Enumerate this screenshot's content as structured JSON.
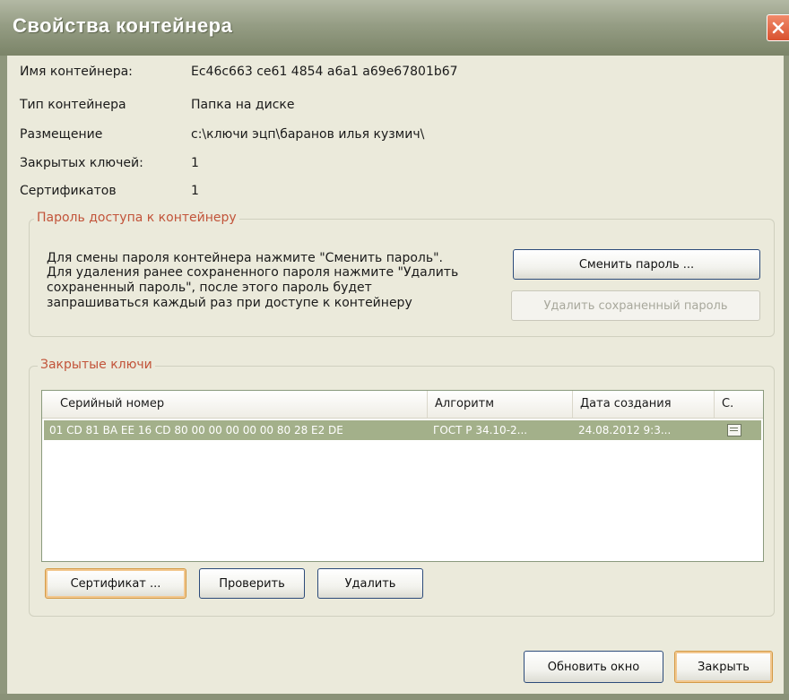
{
  "window": {
    "title": "Свойства контейнера"
  },
  "properties": [
    {
      "label": "Имя контейнера:",
      "value": "Ec46c663 ce61 4854 a6a1 a69e67801b67"
    },
    {
      "label": "Тип контейнера",
      "value": "Папка на диске"
    },
    {
      "label": "Размещение",
      "value": "c:\\ключи эцп\\баранов илья кузмич\\"
    },
    {
      "label": "Закрытых ключей:",
      "value": "1"
    },
    {
      "label": "Сертификатов",
      "value": "1"
    }
  ],
  "password_group": {
    "legend": "Пароль доступа к контейнеру",
    "hint_lines": [
      "Для смены пароля контейнера нажмите \"Сменить пароль\".",
      "Для удаления ранее сохраненного пароля нажмите \"Удалить",
      "сохраненный пароль\", после этого пароль будет",
      "запрашиваться каждый раз при доступе к контейнеру"
    ],
    "change_button": "Сменить пароль ...",
    "delete_button": "Удалить сохраненный пароль"
  },
  "keys_group": {
    "legend": "Закрытые ключи",
    "columns": [
      "Серийный номер",
      "Алгоритм",
      "Дата создания",
      "С."
    ],
    "rows": [
      {
        "serial": "01 CD 81 BA EE 16 CD 80 00 00 00 00 00 80 28 E2 DE",
        "algorithm": "ГОСТ Р 34.10-2...",
        "created": "24.08.2012 9:3...",
        "cert_icon": "certificate-icon"
      }
    ],
    "buttons": {
      "certificate": "Сертификат ...",
      "verify": "Проверить",
      "delete": "Удалить"
    }
  },
  "footer": {
    "refresh_button": "Обновить окно",
    "close_button": "Закрыть"
  }
}
